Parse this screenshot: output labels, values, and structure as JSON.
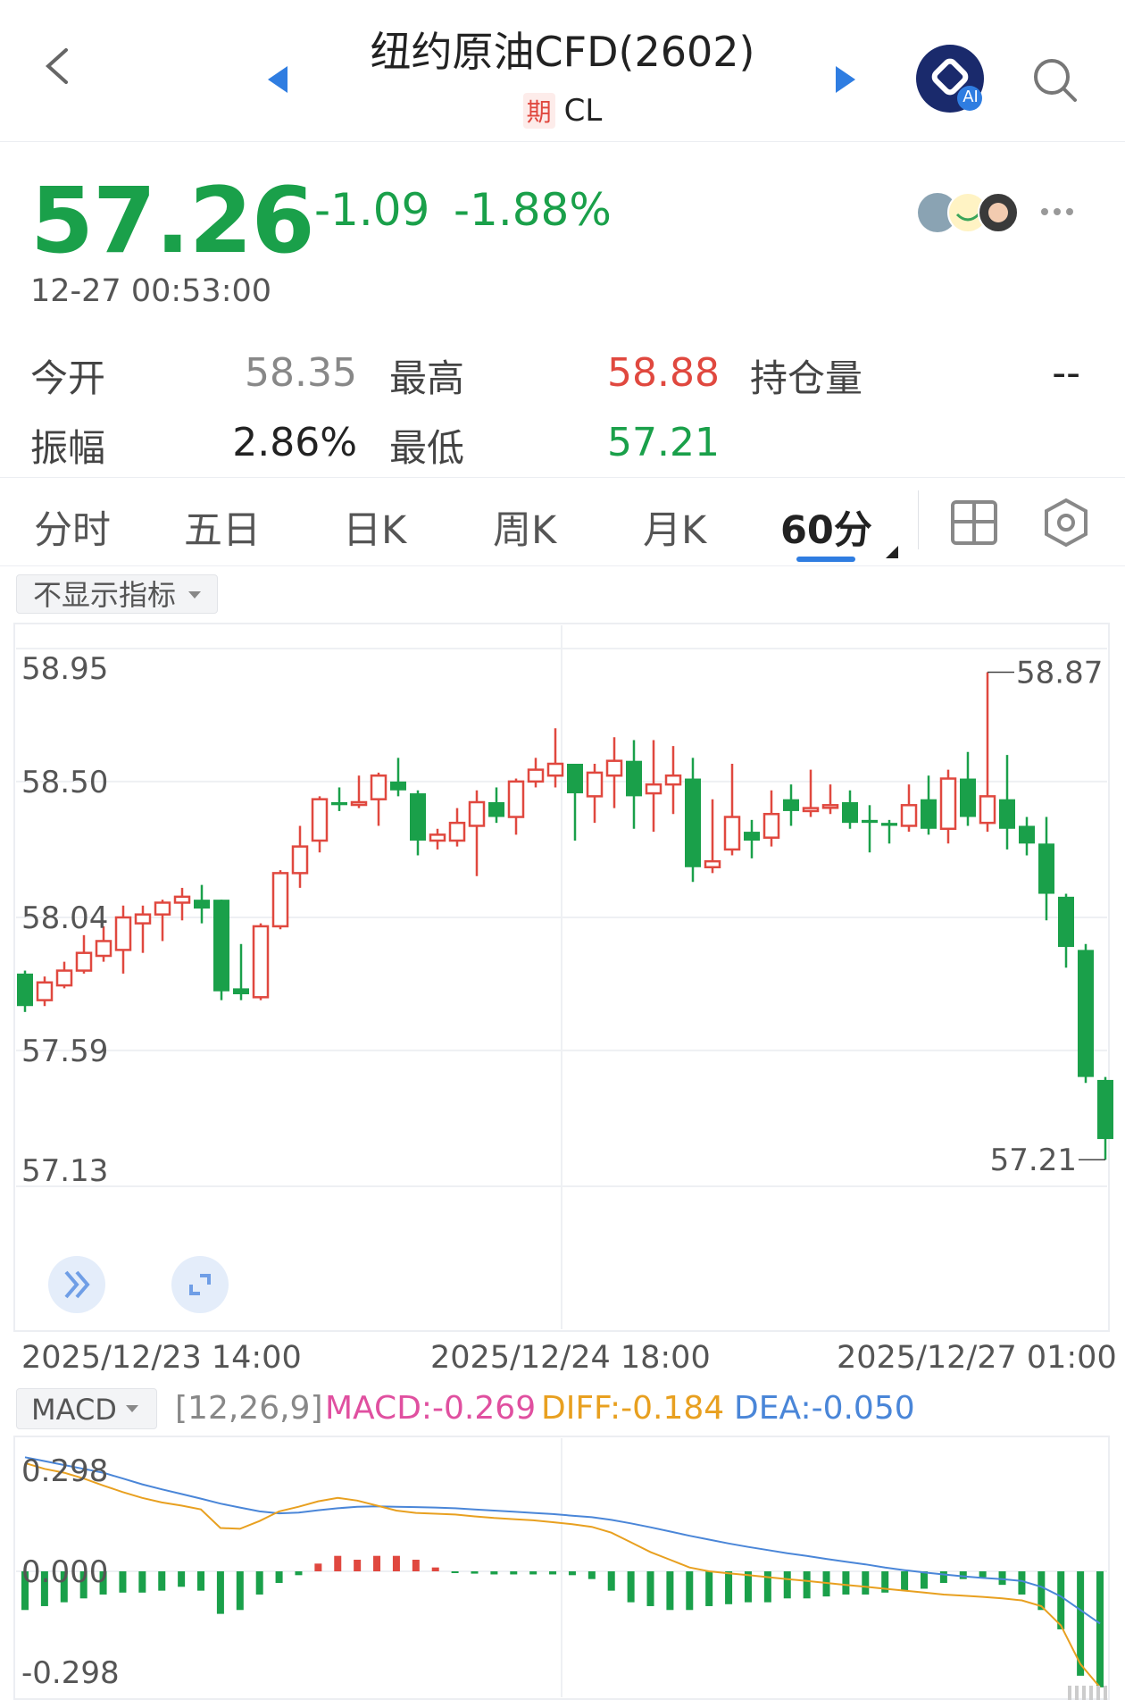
{
  "header": {
    "title": "纽约原油CFD(2602)",
    "badge": "期",
    "code": "CL",
    "ai_badge": "AI"
  },
  "quote": {
    "price": "57.26",
    "change": "-1.09",
    "change_pct": "-1.88%",
    "timestamp": "12-27 00:53:00"
  },
  "stats": {
    "open_label": "今开",
    "open": "58.35",
    "high_label": "最高",
    "high": "58.88",
    "oi_label": "持仓量",
    "oi": "--",
    "amp_label": "振幅",
    "amp": "2.86%",
    "low_label": "最低",
    "low": "57.21"
  },
  "tabs": [
    "分时",
    "五日",
    "日K",
    "周K",
    "月K",
    "60分"
  ],
  "active_tab": "60分",
  "indicator_select": "不显示指标",
  "colors": {
    "up": "#e0483f",
    "down": "#1aa04a",
    "accent": "#2f7de1"
  },
  "chart_data": [
    {
      "type": "candlestick",
      "interval": "60分",
      "y_ticks": [
        "58.95",
        "58.50",
        "58.04",
        "57.59",
        "57.13"
      ],
      "ylim": [
        57.13,
        58.95
      ],
      "x_labels": [
        "2025/12/23 14:00",
        "2025/12/24 18:00",
        "2025/12/27 01:00"
      ],
      "max_mark": "58.87",
      "min_mark": "57.21",
      "candles": [
        [
          57.85,
          57.74,
          57.86,
          57.72
        ],
        [
          57.76,
          57.82,
          57.84,
          57.74
        ],
        [
          57.81,
          57.86,
          57.89,
          57.8
        ],
        [
          57.86,
          57.92,
          57.98,
          57.85
        ],
        [
          57.91,
          57.96,
          58.01,
          57.89
        ],
        [
          57.93,
          58.04,
          58.08,
          57.85
        ],
        [
          58.02,
          58.05,
          58.08,
          57.92
        ],
        [
          58.05,
          58.09,
          58.1,
          57.96
        ],
        [
          58.09,
          58.11,
          58.14,
          58.03
        ],
        [
          58.1,
          58.07,
          58.15,
          58.02
        ],
        [
          58.1,
          57.79,
          58.1,
          57.76
        ],
        [
          57.8,
          57.78,
          57.95,
          57.76
        ],
        [
          57.77,
          58.01,
          58.02,
          57.76
        ],
        [
          58.01,
          58.19,
          58.2,
          58.0
        ],
        [
          58.19,
          58.28,
          58.35,
          58.14
        ],
        [
          58.3,
          58.44,
          58.45,
          58.26
        ],
        [
          58.43,
          58.42,
          58.48,
          58.4
        ],
        [
          58.43,
          58.43,
          58.52,
          58.41
        ],
        [
          58.44,
          58.52,
          58.53,
          58.35
        ],
        [
          58.5,
          58.47,
          58.58,
          58.45
        ],
        [
          58.46,
          58.3,
          58.47,
          58.25
        ],
        [
          58.3,
          58.32,
          58.34,
          58.27
        ],
        [
          58.3,
          58.36,
          58.41,
          58.28
        ],
        [
          58.35,
          58.43,
          58.47,
          58.18
        ],
        [
          58.43,
          58.38,
          58.48,
          58.36
        ],
        [
          58.38,
          58.5,
          58.51,
          58.32
        ],
        [
          58.5,
          58.54,
          58.58,
          58.48
        ],
        [
          58.52,
          58.56,
          58.68,
          58.48
        ],
        [
          58.56,
          58.46,
          58.56,
          58.3
        ],
        [
          58.45,
          58.53,
          58.56,
          58.36
        ],
        [
          58.52,
          58.57,
          58.65,
          58.41
        ],
        [
          58.57,
          58.45,
          58.64,
          58.34
        ],
        [
          58.46,
          58.49,
          58.64,
          58.33
        ],
        [
          58.49,
          58.52,
          58.62,
          58.39
        ],
        [
          58.51,
          58.21,
          58.58,
          58.16
        ],
        [
          58.21,
          58.23,
          58.44,
          58.19
        ],
        [
          58.27,
          58.38,
          58.56,
          58.25
        ],
        [
          58.33,
          58.3,
          58.37,
          58.24
        ],
        [
          58.31,
          58.39,
          58.47,
          58.28
        ],
        [
          58.44,
          58.4,
          58.49,
          58.35
        ],
        [
          58.4,
          58.41,
          58.54,
          58.38
        ],
        [
          58.42,
          58.42,
          58.49,
          58.39
        ],
        [
          58.43,
          58.36,
          58.47,
          58.34
        ],
        [
          58.37,
          58.36,
          58.42,
          58.26
        ],
        [
          58.36,
          58.35,
          58.37,
          58.29
        ],
        [
          58.35,
          58.42,
          58.49,
          58.33
        ],
        [
          58.44,
          58.34,
          58.52,
          58.32
        ],
        [
          58.34,
          58.51,
          58.54,
          58.29
        ],
        [
          58.51,
          58.38,
          58.6,
          58.35
        ],
        [
          58.36,
          58.45,
          58.87,
          58.33
        ],
        [
          58.44,
          58.34,
          58.59,
          58.27
        ],
        [
          58.35,
          58.29,
          58.38,
          58.25
        ],
        [
          58.29,
          58.12,
          58.38,
          58.03
        ],
        [
          58.11,
          57.94,
          58.12,
          57.87
        ],
        [
          57.93,
          57.5,
          57.95,
          57.48
        ],
        [
          57.49,
          57.29,
          57.5,
          57.22
        ]
      ]
    },
    {
      "type": "bar",
      "name": "MACD",
      "params": "[12,26,9]",
      "macd_label": "MACD:-0.269",
      "diff_label": "DIFF:-0.184",
      "dea_label": "DEA:-0.050",
      "y_ticks": [
        "0.298",
        "0.000",
        "-0.298"
      ],
      "ylim": [
        -0.298,
        0.298
      ],
      "series": [
        {
          "name": "DIFF",
          "values": [
            0.28,
            0.265,
            0.255,
            0.24,
            0.222,
            0.205,
            0.19,
            0.178,
            0.17,
            0.16,
            0.112,
            0.11,
            0.13,
            0.155,
            0.167,
            0.181,
            0.19,
            0.183,
            0.17,
            0.157,
            0.151,
            0.149,
            0.147,
            0.142,
            0.138,
            0.135,
            0.132,
            0.127,
            0.122,
            0.115,
            0.1,
            0.075,
            0.05,
            0.03,
            0.01,
            0.0,
            -0.005,
            -0.01,
            -0.015,
            -0.02,
            -0.025,
            -0.03,
            -0.035,
            -0.04,
            -0.045,
            -0.05,
            -0.055,
            -0.06,
            -0.063,
            -0.066,
            -0.07,
            -0.075,
            -0.09,
            -0.14,
            -0.24,
            -0.3
          ]
        },
        {
          "name": "DEA",
          "values": [
            0.295,
            0.285,
            0.275,
            0.265,
            0.255,
            0.24,
            0.225,
            0.212,
            0.2,
            0.188,
            0.175,
            0.165,
            0.155,
            0.15,
            0.152,
            0.158,
            0.163,
            0.167,
            0.168,
            0.167,
            0.166,
            0.165,
            0.163,
            0.16,
            0.157,
            0.154,
            0.151,
            0.148,
            0.144,
            0.14,
            0.133,
            0.124,
            0.114,
            0.103,
            0.092,
            0.082,
            0.072,
            0.063,
            0.055,
            0.047,
            0.04,
            0.032,
            0.025,
            0.018,
            0.01,
            0.003,
            -0.003,
            -0.008,
            -0.013,
            -0.017,
            -0.02,
            -0.025,
            -0.04,
            -0.065,
            -0.1,
            -0.135
          ]
        },
        {
          "name": "MACD",
          "values": [
            -0.1,
            -0.09,
            -0.08,
            -0.07,
            -0.06,
            -0.055,
            -0.055,
            -0.05,
            -0.04,
            -0.05,
            -0.11,
            -0.1,
            -0.06,
            -0.03,
            -0.01,
            0.02,
            0.04,
            0.03,
            0.04,
            0.04,
            0.03,
            0.01,
            -0.004,
            -0.006,
            -0.008,
            -0.008,
            -0.008,
            -0.008,
            -0.01,
            -0.02,
            -0.05,
            -0.08,
            -0.09,
            -0.1,
            -0.1,
            -0.09,
            -0.085,
            -0.08,
            -0.08,
            -0.07,
            -0.07,
            -0.065,
            -0.06,
            -0.06,
            -0.055,
            -0.05,
            -0.045,
            -0.03,
            -0.02,
            -0.015,
            -0.035,
            -0.06,
            -0.1,
            -0.15,
            -0.27,
            -0.3
          ]
        }
      ]
    }
  ]
}
